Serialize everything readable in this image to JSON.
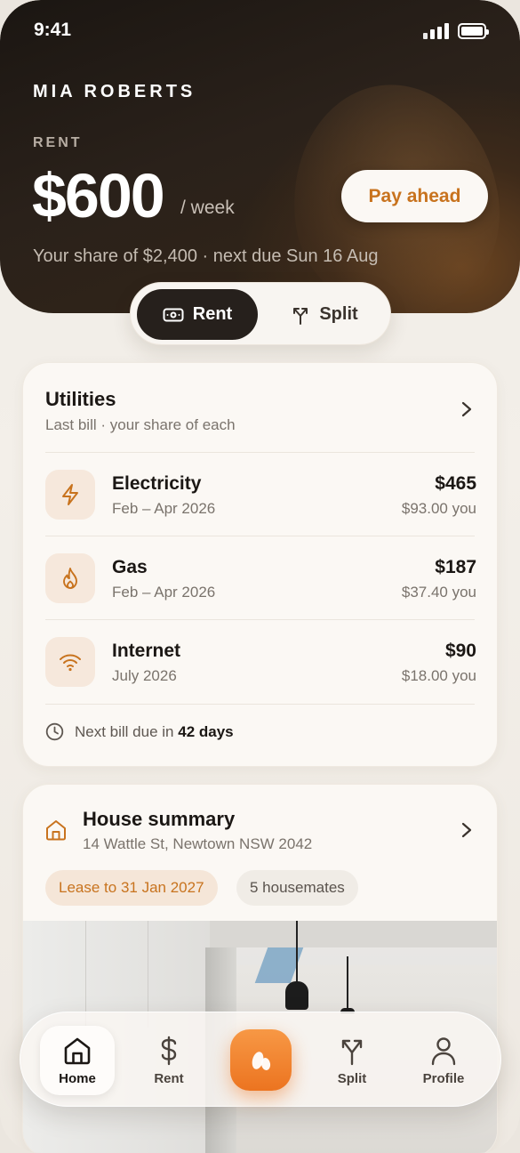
{
  "status_bar": {
    "time": "9:41"
  },
  "hero": {
    "user_name": "MIA ROBERTS",
    "label": "RENT",
    "amount": "$600",
    "period": "/ week",
    "share_text": "Your share of $2,400 · next due Sun 16 Aug",
    "pay_button": "Pay ahead",
    "accent_color": "#c8731e"
  },
  "segment": {
    "selected": "Rent",
    "items": [
      {
        "label": "Rent",
        "icon": "cash-icon"
      },
      {
        "label": "Split",
        "icon": "split-arrows-icon"
      }
    ]
  },
  "utilities": {
    "title": "Utilities",
    "subtitle": "Last bill · your share of each",
    "items": [
      {
        "name": "Electricity",
        "period": "Feb – Apr 2026",
        "total": "$465",
        "your_share": "$93.00 you",
        "icon": "lightning-icon"
      },
      {
        "name": "Gas",
        "period": "Feb – Apr 2026",
        "total": "$187",
        "your_share": "$37.40 you",
        "icon": "flame-icon"
      },
      {
        "name": "Internet",
        "period": "July 2026",
        "total": "$90",
        "your_share": "$18.00 you",
        "icon": "wifi-icon"
      }
    ],
    "next_bill_prefix": "Next bill due in",
    "next_bill_value": "42 days"
  },
  "house": {
    "title": "House summary",
    "address": "14 Wattle St, Newtown NSW 2042",
    "lease_chip": "Lease to 31 Jan 2027",
    "housemates_chip": "5 housemates"
  },
  "bottom_nav": {
    "active": "Home",
    "items": [
      {
        "label": "Home",
        "icon": "home-icon"
      },
      {
        "label": "Rent",
        "icon": "dollar-icon"
      },
      {
        "label": "",
        "icon": "app-logo-icon"
      },
      {
        "label": "Split",
        "icon": "split-arrows-icon"
      },
      {
        "label": "Profile",
        "icon": "user-icon"
      }
    ]
  }
}
